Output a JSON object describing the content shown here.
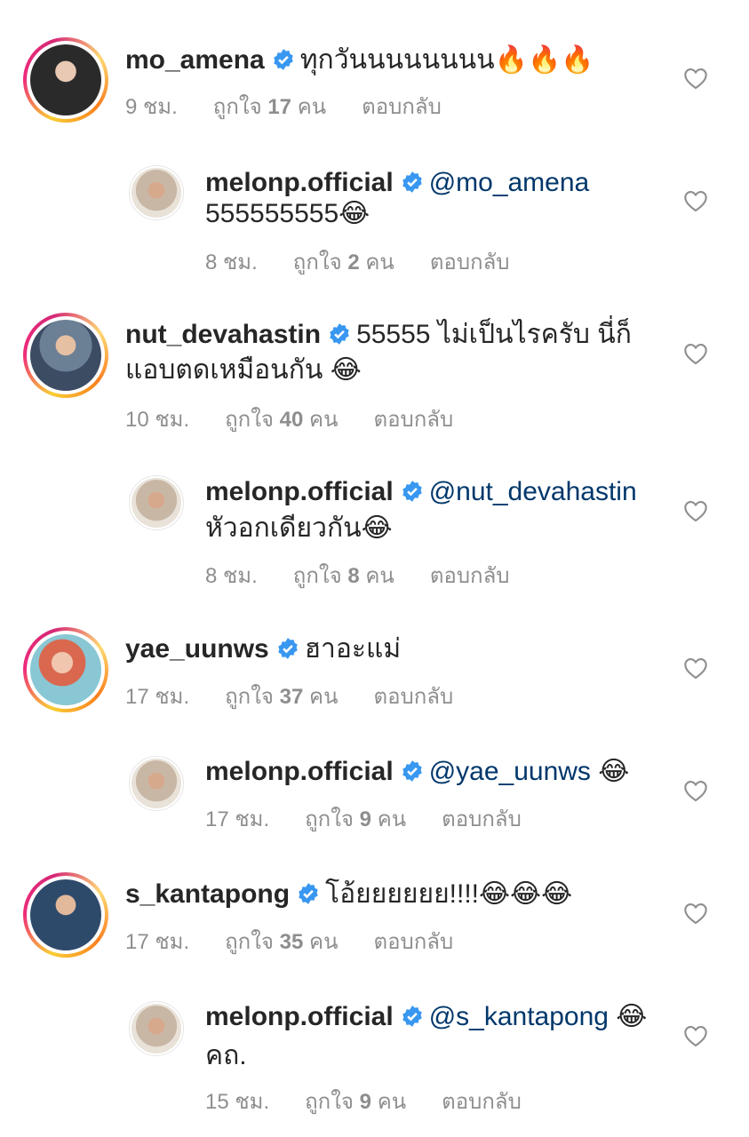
{
  "comments": [
    {
      "user": "mo_amena",
      "text": "ทุกวันนนนนนนน🔥🔥🔥",
      "time": "9 ชม.",
      "likes_prefix": "ถูกใจ",
      "likes_count": "17",
      "likes_suffix": "คน",
      "reply": "ตอบกลับ",
      "avatar_color": "#2b2b2b"
    },
    {
      "user": "melonp.official",
      "mention": "@mo_amena",
      "text2": "555555555😂",
      "time": "8 ชม.",
      "likes_prefix": "ถูกใจ",
      "likes_count": "2",
      "likes_suffix": "คน",
      "reply": "ตอบกลับ"
    },
    {
      "user": "nut_devahastin",
      "text": "55555 ไม่เป็นไรครับ นี่ก็",
      "text2": "แอบตดเหมือนกัน 😂",
      "time": "10 ชม.",
      "likes_prefix": "ถูกใจ",
      "likes_count": "40",
      "likes_suffix": "คน",
      "reply": "ตอบกลับ"
    },
    {
      "user": "melonp.official",
      "mention": "@nut_devahastin",
      "text2": "หัวอกเดียวกัน😂",
      "time": "8 ชม.",
      "likes_prefix": "ถูกใจ",
      "likes_count": "8",
      "likes_suffix": "คน",
      "reply": "ตอบกลับ"
    },
    {
      "user": "yae_uunws",
      "text": "ฮาอะแม่",
      "time": "17 ชม.",
      "likes_prefix": "ถูกใจ",
      "likes_count": "37",
      "likes_suffix": "คน",
      "reply": "ตอบกลับ"
    },
    {
      "user": "melonp.official",
      "mention": "@yae_uunws",
      "text": "😂",
      "time": "17 ชม.",
      "likes_prefix": "ถูกใจ",
      "likes_count": "9",
      "likes_suffix": "คน",
      "reply": "ตอบกลับ"
    },
    {
      "user": "s_kantapong",
      "text": "โอ้ยยยยยย!!!!😂😂😂",
      "time": "17 ชม.",
      "likes_prefix": "ถูกใจ",
      "likes_count": "35",
      "likes_suffix": "คน",
      "reply": "ตอบกลับ"
    },
    {
      "user": "melonp.official",
      "mention": "@s_kantapong",
      "text": "😂",
      "text2": "คถ.",
      "time": "15 ชม.",
      "likes_prefix": "ถูกใจ",
      "likes_count": "9",
      "likes_suffix": "คน",
      "reply": "ตอบกลับ"
    }
  ],
  "colors": {
    "text": "#262626",
    "meta": "#8e8e8e",
    "mention": "#00376b",
    "verified": "#3897f0"
  }
}
